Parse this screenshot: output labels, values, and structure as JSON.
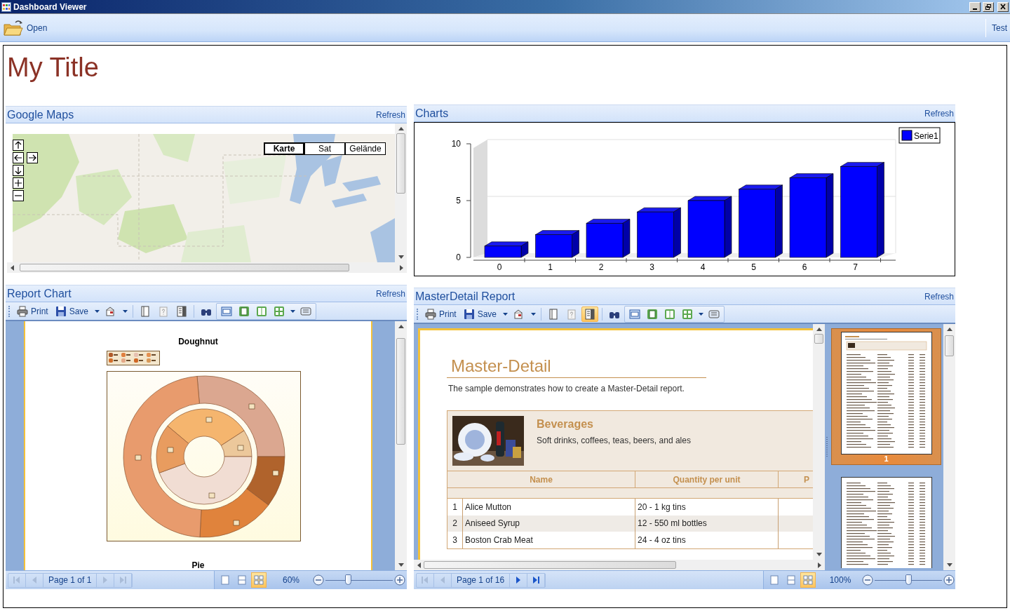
{
  "window": {
    "title": "Dashboard Viewer"
  },
  "toolbar": {
    "open_label": "Open",
    "right_label": "Test"
  },
  "page_title": "My Title",
  "maps": {
    "title": "Google Maps",
    "refresh": "Refresh",
    "map_types": [
      {
        "label": "Karte",
        "selected": true
      },
      {
        "label": "Sat",
        "selected": false
      },
      {
        "label": "Gelände",
        "selected": false
      }
    ]
  },
  "charts": {
    "title": "Charts",
    "refresh": "Refresh",
    "chart_data": {
      "type": "bar",
      "categories": [
        "0",
        "1",
        "2",
        "3",
        "4",
        "5",
        "6",
        "7"
      ],
      "series": [
        {
          "name": "Serie1",
          "color": "#0000ff",
          "values": [
            1,
            2,
            3,
            4,
            5,
            6,
            7,
            8
          ]
        }
      ],
      "ylim": [
        0,
        10
      ],
      "yticks": [
        0,
        5,
        10
      ]
    }
  },
  "report_chart": {
    "title": "Report Chart",
    "refresh": "Refresh",
    "toolbar": {
      "print": "Print",
      "save": "Save",
      "tools": [
        {
          "on": false
        },
        {
          "on": false
        },
        {
          "on": false
        },
        {
          "on": false
        },
        {
          "on": false
        },
        {
          "on": false
        },
        {
          "on": false
        },
        {
          "on": false
        },
        {
          "on": false
        },
        {
          "on": false
        }
      ]
    },
    "page": {
      "heading": "Doughnut",
      "next_heading": "Pie"
    },
    "status": {
      "nav": [
        {
          "disabled": true
        },
        {
          "disabled": true
        },
        {
          "disabled": true
        },
        {
          "disabled": true
        }
      ],
      "page_text": "Page 1 of 1",
      "views": [
        {
          "selected": false
        },
        {
          "selected": false
        },
        {
          "selected": true
        }
      ],
      "zoom": "60%",
      "zoom_slider": {
        "level": 0.33
      }
    }
  },
  "master_detail": {
    "title": "MasterDetail Report",
    "refresh": "Refresh",
    "toolbar": {
      "print": "Print",
      "save": "Save",
      "tools": [
        {
          "on": false
        },
        {
          "on": false
        },
        {
          "on": false
        },
        {
          "on": true
        },
        {
          "on": false
        },
        {
          "on": false
        },
        {
          "on": false
        },
        {
          "on": false
        },
        {
          "on": false
        },
        {
          "on": false
        }
      ]
    },
    "document": {
      "title": "Master-Detail",
      "description": "The sample demonstrates how to create a Master-Detail report.",
      "category": {
        "name": "Beverages",
        "description": "Soft drinks, coffees, teas, beers, and ales"
      },
      "columns": [
        "Name",
        "Quantity per unit",
        "P"
      ],
      "rows": [
        {
          "number": "1",
          "name": "Alice Mutton",
          "quantity": "20 - 1 kg tins"
        },
        {
          "number": "2",
          "name": "Aniseed Syrup",
          "quantity": "12 - 550 ml bottles"
        },
        {
          "number": "3",
          "name": "Boston Crab Meat",
          "quantity": "24 - 4 oz tins"
        }
      ]
    },
    "thumbnails": [
      {
        "label": "1",
        "selected": true
      },
      {
        "selected": false
      }
    ],
    "status": {
      "nav": [
        {
          "disabled": true
        },
        {
          "disabled": true
        },
        {
          "disabled": false
        },
        {
          "disabled": false
        }
      ],
      "page_text": "Page 1 of 16",
      "views": [
        {
          "selected": false
        },
        {
          "selected": false
        },
        {
          "selected": true
        }
      ],
      "zoom": "100%",
      "zoom_slider": {
        "level": 0.5
      }
    }
  }
}
